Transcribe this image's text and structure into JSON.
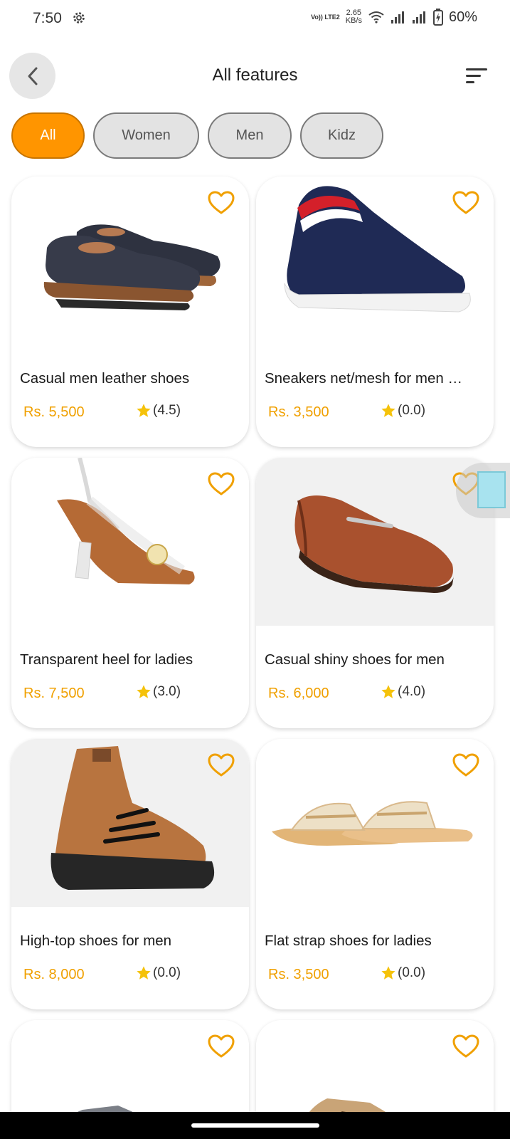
{
  "status_bar": {
    "time": "7:50",
    "volte_label": "Vo)) LTE2",
    "net_speed": "2.65",
    "net_speed_unit": "KB/s",
    "battery": "60%"
  },
  "header": {
    "title": "All features",
    "back_icon": "chevron-left-icon",
    "sort_icon": "sort-icon"
  },
  "filters": {
    "chips": [
      {
        "label": "All",
        "active": true
      },
      {
        "label": "Women",
        "active": false
      },
      {
        "label": "Men",
        "active": false
      },
      {
        "label": "Kidz",
        "active": false
      }
    ]
  },
  "products": [
    {
      "name": "Casual men leather shoes",
      "price": "Rs. 5,500",
      "rating": "(4.5)"
    },
    {
      "name": "Sneakers net/mesh for men …",
      "price": "Rs. 3,500",
      "rating": "(0.0)"
    },
    {
      "name": "Transparent heel for ladies",
      "price": "Rs. 7,500",
      "rating": "(3.0)"
    },
    {
      "name": "Casual shiny shoes for men",
      "price": "Rs. 6,000",
      "rating": "(4.0)"
    },
    {
      "name": "High-top shoes for men",
      "price": "Rs. 8,000",
      "rating": "(0.0)"
    },
    {
      "name": "Flat strap shoes for ladies",
      "price": "Rs. 3,500",
      "rating": "(0.0)"
    }
  ],
  "colors": {
    "accent": "#ff9500",
    "price": "#f0a000",
    "heart": "#f0a000"
  }
}
